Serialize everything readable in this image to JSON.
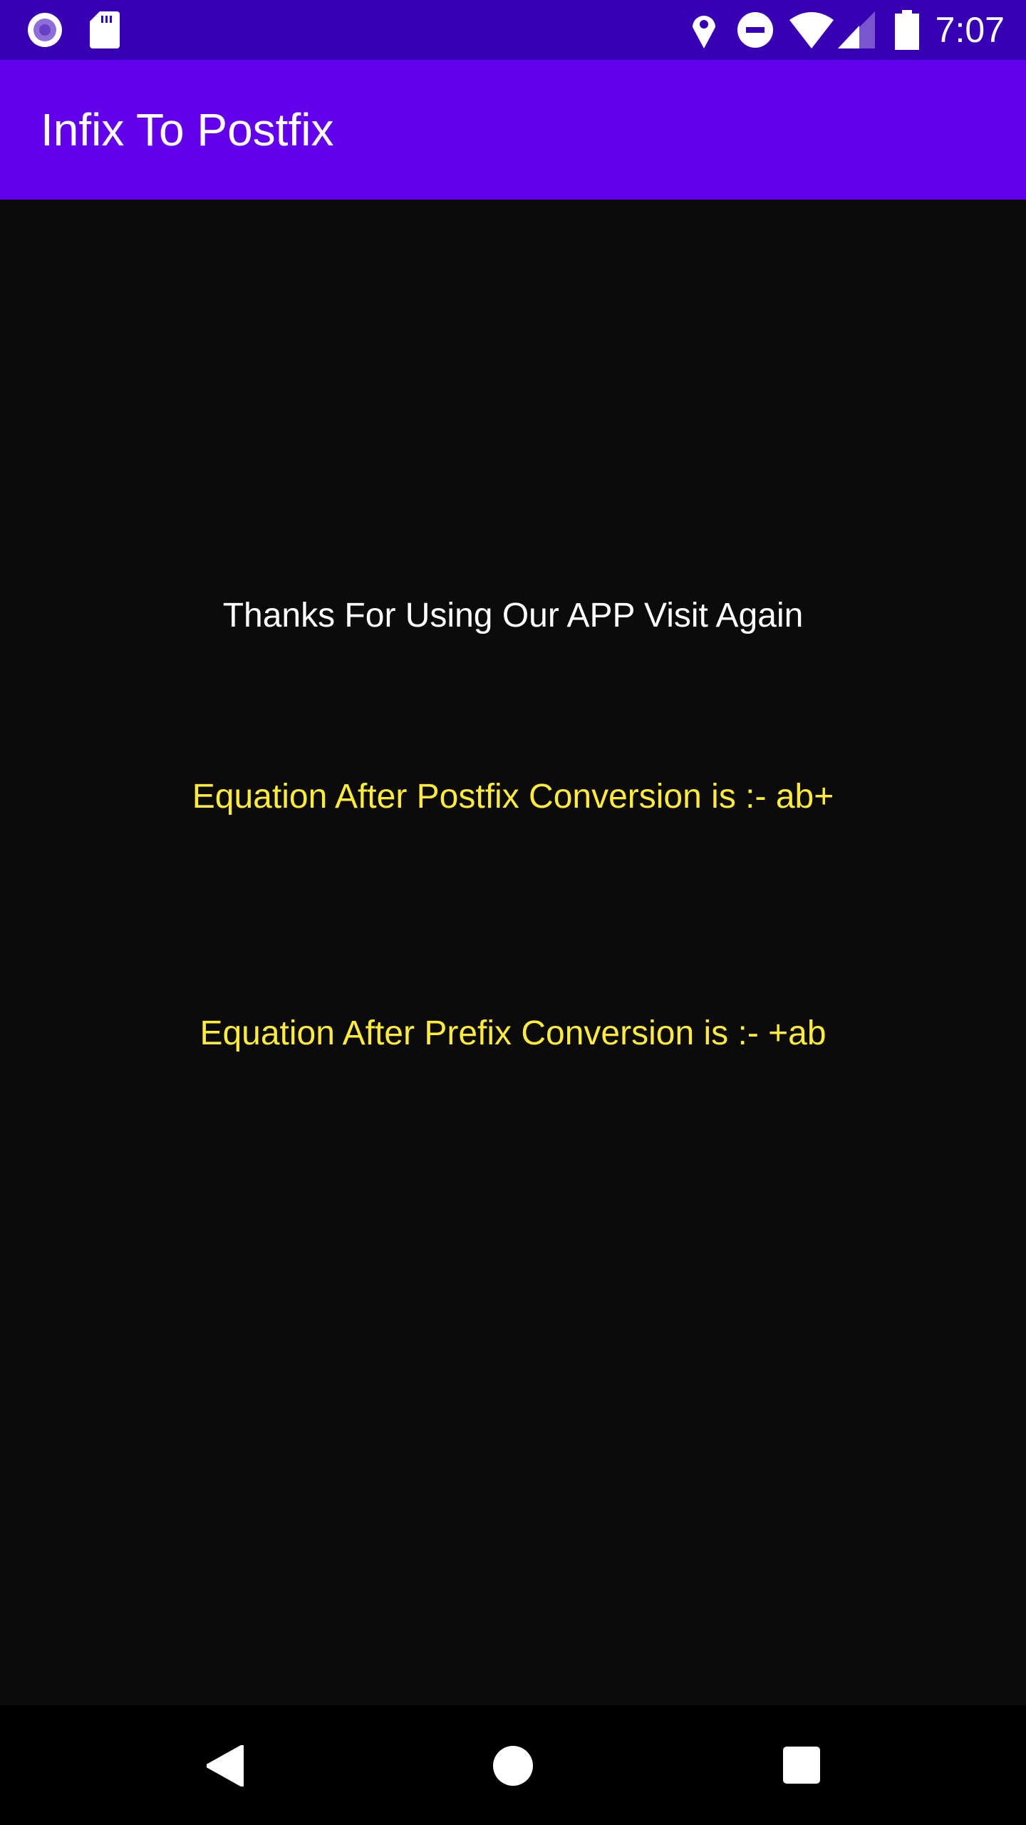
{
  "status_bar": {
    "time": "7:07",
    "left_icons": [
      "radio-record-icon",
      "sd-card-icon"
    ],
    "right_icons": [
      "location-icon",
      "do-not-disturb-icon",
      "wifi-icon",
      "signal-icon",
      "battery-icon"
    ]
  },
  "app_bar": {
    "title": "Infix To Postfix"
  },
  "main": {
    "thanks": "Thanks For Using Our APP Visit Again",
    "postfix_result": "Equation After Postfix Conversion is :- ab+",
    "prefix_result": "Equation After Prefix Conversion is :- +ab"
  },
  "colors": {
    "status_bar": "#3700b3",
    "app_bar": "#6200ee",
    "result_text": "#ffeb3b",
    "background": "#0b0b0b"
  },
  "nav_bar": {
    "icons": [
      "back-icon",
      "home-icon",
      "recents-icon"
    ]
  }
}
